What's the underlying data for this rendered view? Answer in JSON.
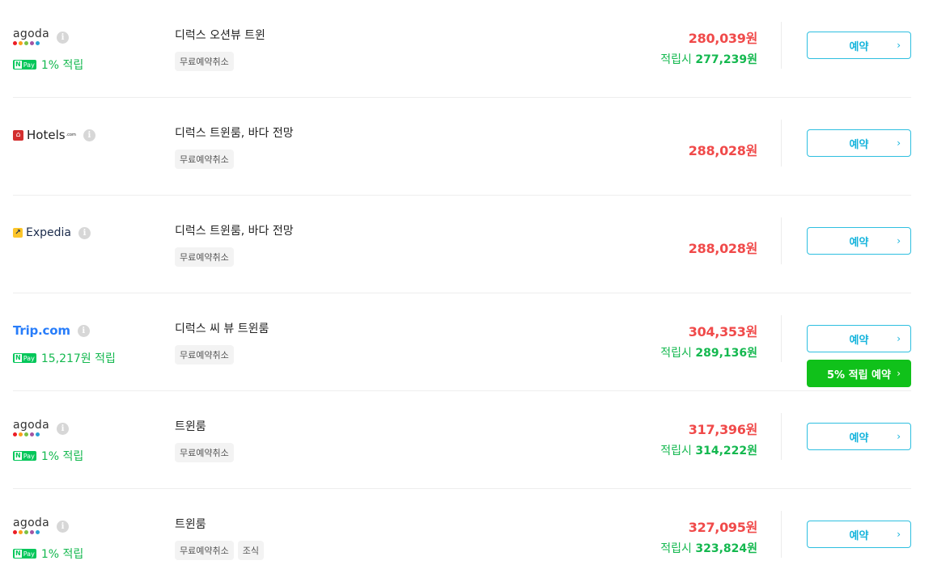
{
  "offers": [
    {
      "provider": "agoda",
      "npay_text": "1% 적립",
      "room_name": "디럭스 오션뷰 트윈",
      "tags": [
        "무료예약취소"
      ],
      "price": "280,039원",
      "point_label": "적립시",
      "point_price": "277,239원",
      "button_label": "예약"
    },
    {
      "provider": "hotels",
      "room_name": "디럭스 트윈룸, 바다 전망",
      "tags": [
        "무료예약취소"
      ],
      "price": "288,028원",
      "button_label": "예약"
    },
    {
      "provider": "expedia",
      "room_name": "디럭스 트윈룸, 바다 전망",
      "tags": [
        "무료예약취소"
      ],
      "price": "288,028원",
      "button_label": "예약"
    },
    {
      "provider": "trip",
      "npay_text": "15,217원 적립",
      "room_name": "디럭스 씨 뷰 트윈룸",
      "tags": [
        "무료예약취소"
      ],
      "price": "304,353원",
      "point_label": "적립시",
      "point_price": "289,136원",
      "button_label": "예약",
      "green_button_label": "5% 적립 예약"
    },
    {
      "provider": "agoda",
      "npay_text": "1% 적립",
      "room_name": "트윈룸",
      "tags": [
        "무료예약취소"
      ],
      "price": "317,396원",
      "point_label": "적립시",
      "point_price": "314,222원",
      "button_label": "예약"
    },
    {
      "provider": "agoda",
      "npay_text": "1% 적립",
      "room_name": "트윈룸",
      "tags": [
        "무료예약취소",
        "조식"
      ],
      "price": "327,095원",
      "point_label": "적립시",
      "point_price": "323,824원",
      "button_label": "예약"
    }
  ],
  "logos": {
    "agoda": "agoda",
    "agoda_dot_colors": [
      "#ec1c24",
      "#f9a11b",
      "#7dc243",
      "#a453a1",
      "#2a9fd6"
    ],
    "hotels": "Hotels",
    "hotels_sup": ".com",
    "expedia": "Expedia",
    "trip": "Trip.com",
    "npay_n": "N",
    "npay_pay": "Pay",
    "info_glyph": "i"
  },
  "colors": {
    "price_red": "#f04a4a",
    "point_green": "#14b84f",
    "button_cyan": "#2ebfe0",
    "button_green": "#10c11a"
  }
}
